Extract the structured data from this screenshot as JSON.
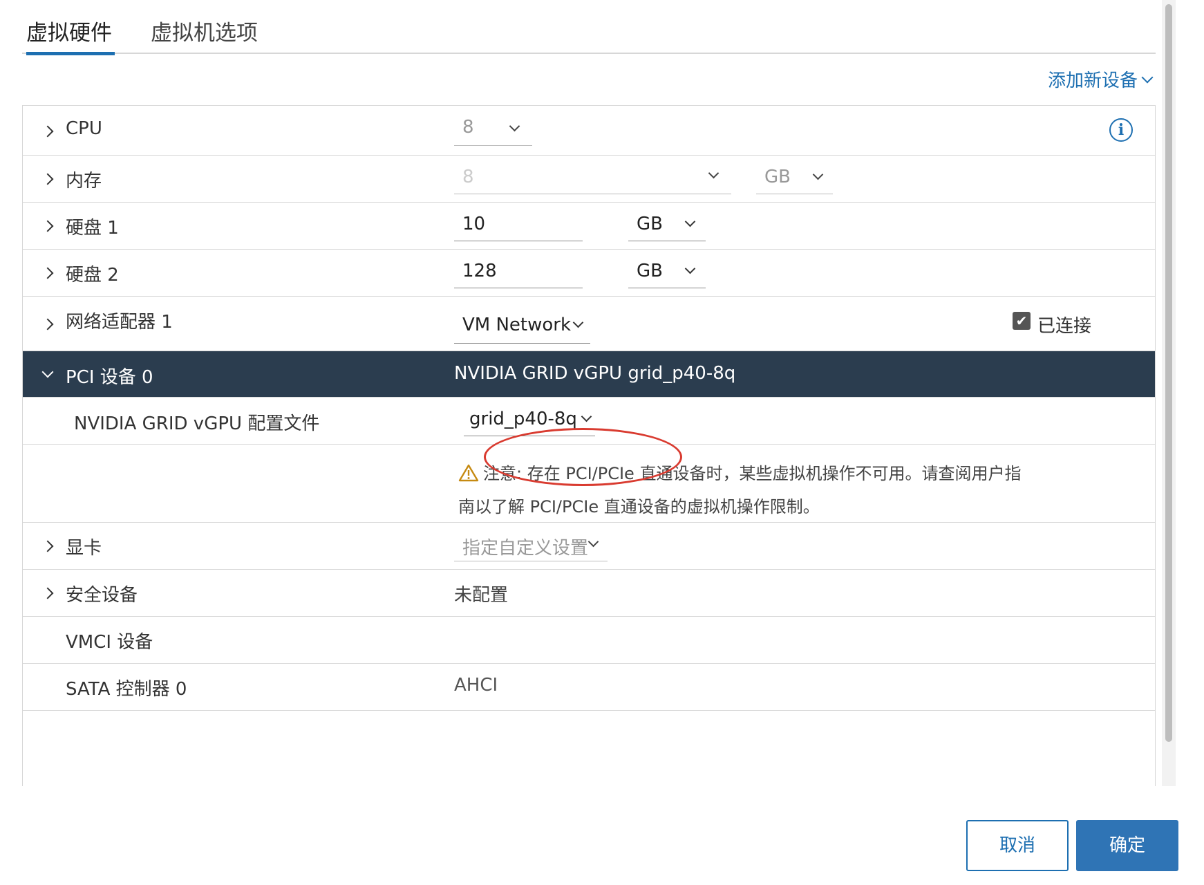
{
  "tabs": [
    {
      "label": "虚拟硬件",
      "active": true
    },
    {
      "label": "虚拟机选项",
      "active": false
    }
  ],
  "add_device": {
    "label": "添加新设备"
  },
  "hardware": {
    "cpu": {
      "label": "CPU",
      "value": "8"
    },
    "memory": {
      "label": "内存",
      "value": "8",
      "unit": "GB"
    },
    "disk1": {
      "label": "硬盘 1",
      "value": "10",
      "unit": "GB"
    },
    "disk2": {
      "label": "硬盘 2",
      "value": "128",
      "unit": "GB"
    },
    "network1": {
      "label": "网络适配器 1",
      "value": "VM Network",
      "connected_label": "已连接",
      "connected": true
    },
    "pci0": {
      "label": "PCI 设备 0",
      "value": "NVIDIA GRID vGPU grid_p40-8q",
      "profile_label": "NVIDIA GRID vGPU 配置文件",
      "profile_value": "grid_p40-8q",
      "warning": "注意: 存在 PCI/PCIe 直通设备时，某些虚拟机操作不可用。请查阅用户指南以了解 PCI/PCIe 直通设备的虚拟机操作限制。"
    },
    "video": {
      "label": "显卡",
      "value": "指定自定义设置"
    },
    "security": {
      "label": "安全设备",
      "value": "未配置"
    },
    "vmci": {
      "label": "VMCI 设备"
    },
    "sata0": {
      "label": "SATA 控制器 0",
      "value": "AHCI"
    }
  },
  "buttons": {
    "cancel": "取消",
    "ok": "确定"
  },
  "colors": {
    "accent": "#1d6fb1",
    "pci_header_bg": "#2b3d4f",
    "highlight": "#d93b30"
  }
}
